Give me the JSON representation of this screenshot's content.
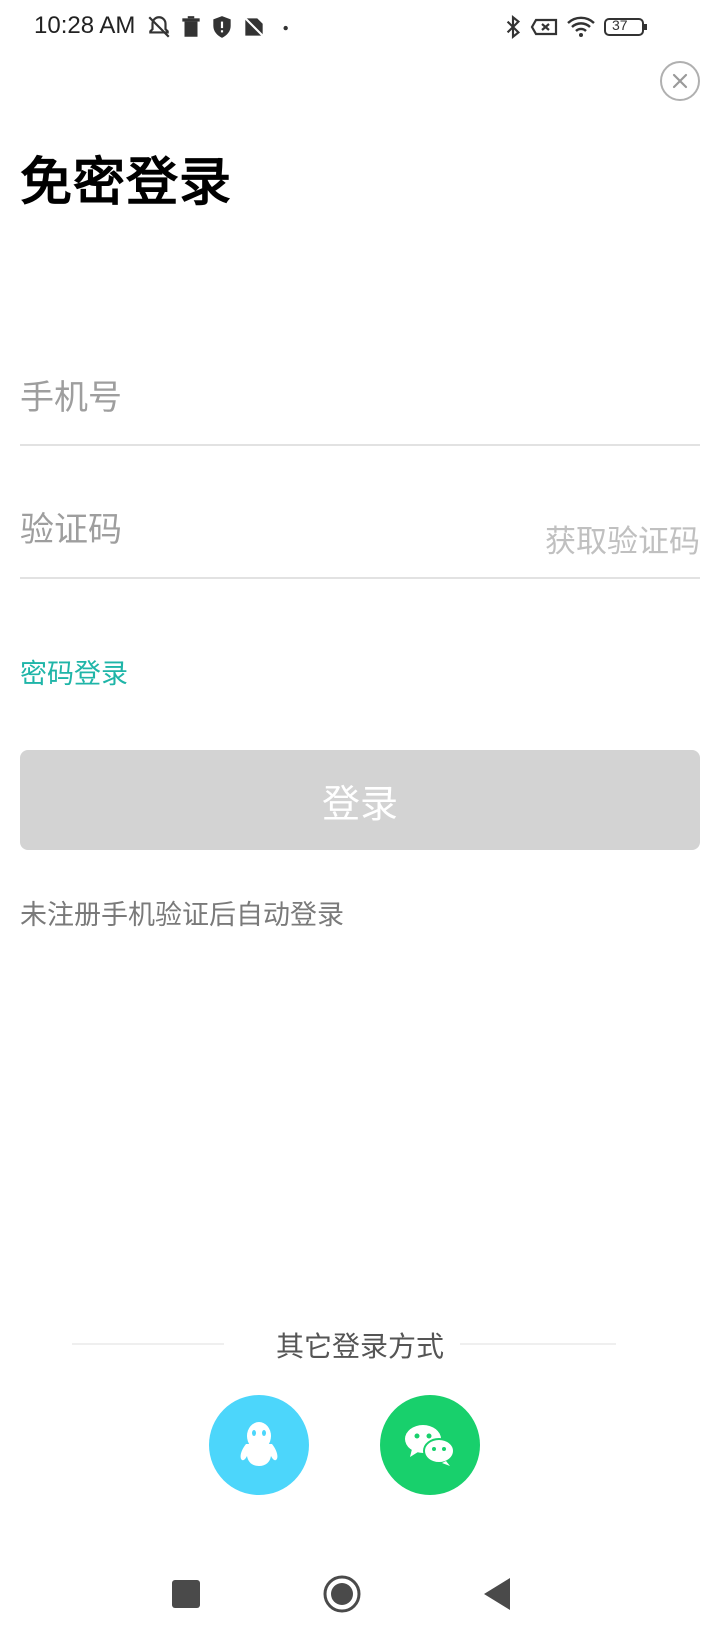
{
  "status_bar": {
    "time": "10:28 AM",
    "battery_level": "37",
    "icons": [
      "notifications-off-icon",
      "trash-icon",
      "shield-icon",
      "no-sim-icon",
      "dot-icon",
      "bluetooth-icon",
      "data-off-icon",
      "wifi-icon",
      "battery-icon"
    ]
  },
  "header": {
    "close_icon": "close-icon",
    "title": "免密登录"
  },
  "form": {
    "phone_placeholder": "手机号",
    "phone_value": "",
    "code_placeholder": "验证码",
    "code_value": "",
    "get_code_label": "获取验证码",
    "password_login_label": "密码登录",
    "login_button_label": "登录",
    "hint": "未注册手机验证后自动登录"
  },
  "other_login": {
    "label": "其它登录方式",
    "options": [
      {
        "icon": "qq-icon",
        "color": "#4cd6fb"
      },
      {
        "icon": "wechat-icon",
        "color": "#18d06c"
      }
    ]
  },
  "nav_bar": {
    "icons": [
      "recents-square-icon",
      "home-circle-icon",
      "back-triangle-icon"
    ]
  },
  "colors": {
    "accent": "#1fb5a8",
    "login_disabled": "#d3d3d3",
    "qq": "#4cd6fb",
    "wechat": "#18d06c"
  }
}
